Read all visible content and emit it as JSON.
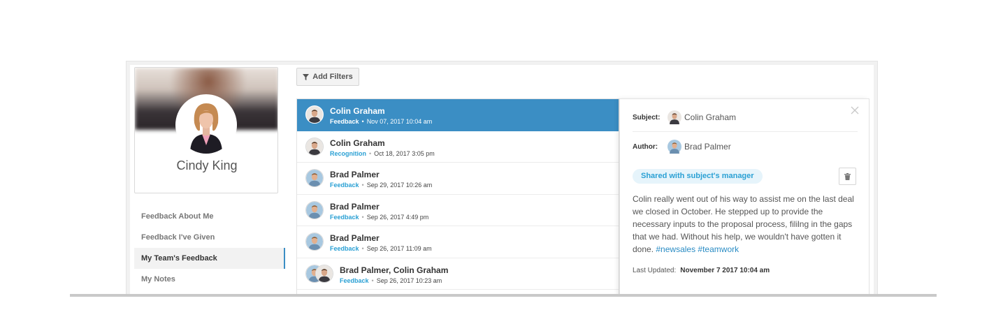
{
  "profile": {
    "name": "Cindy King"
  },
  "nav": {
    "items": [
      {
        "label": "Feedback About Me"
      },
      {
        "label": "Feedback I've Given"
      },
      {
        "label": "My Team's Feedback"
      },
      {
        "label": "My Notes"
      }
    ],
    "active_index": 2
  },
  "toolbar": {
    "filter_label": "Add Filters",
    "filter_icon": "filter-icon"
  },
  "list": {
    "separator": "•",
    "rows": [
      {
        "name": "Colin Graham",
        "type": "Feedback",
        "date": "Nov 07, 2017 10:04 am",
        "selected": true
      },
      {
        "name": "Colin Graham",
        "type": "Recognition",
        "date": "Oct 18, 2017 3:05 pm"
      },
      {
        "name": "Brad Palmer",
        "type": "Feedback",
        "date": "Sep 29, 2017 10:26 am"
      },
      {
        "name": "Brad Palmer",
        "type": "Feedback",
        "date": "Sep 26, 2017 4:49 pm"
      },
      {
        "name": "Brad Palmer",
        "type": "Feedback",
        "date": "Sep 26, 2017 11:09 am"
      },
      {
        "name": "Brad Palmer, Colin Graham",
        "type": "Feedback",
        "date": "Sep 26, 2017 10:23 am"
      }
    ]
  },
  "detail": {
    "subject_label": "Subject:",
    "subject_name": "Colin Graham",
    "author_label": "Author:",
    "author_name": "Brad Palmer",
    "shared_badge": "Shared with subject's manager",
    "body": "Colin really went out of his way to assist me on the last deal we closed in October. He stepped up to provide the necessary inputs to the proposal process, fililng in the gaps that we had. Without his help, we wouldn't have gotten it done.",
    "tags": [
      "#newsales",
      "#teamwork"
    ],
    "updated_label": "Last Updated:",
    "updated_value": "November 7 2017 10:04 am"
  },
  "colors": {
    "accent": "#3b8ec4",
    "link": "#2aa0d4",
    "badge_bg": "#e6f4fb"
  }
}
